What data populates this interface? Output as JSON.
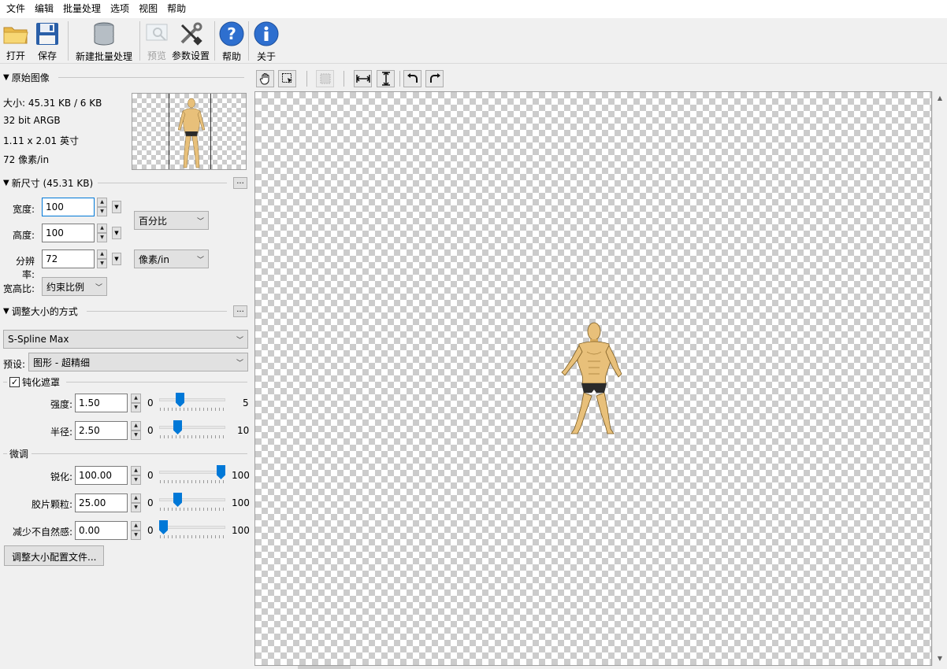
{
  "menu": [
    "文件",
    "编辑",
    "批量处理",
    "选项",
    "视图",
    "帮助"
  ],
  "toolbar": {
    "open": "打开",
    "save": "保存",
    "new_batch": "新建批量处理",
    "preview": "预览",
    "settings": "参数设置",
    "help": "帮助",
    "about": "关于"
  },
  "original": {
    "header": "原始图像",
    "size": "大小: 45.31 KB / 6 KB",
    "bits": "32 bit ARGB",
    "dimensions": "1.11 x 2.01 英寸",
    "resolution": "72 像素/in"
  },
  "new_size": {
    "header": "新尺寸 (45.31 KB)",
    "dots": "...",
    "width_label": "宽度:",
    "width_value": "100",
    "height_label": "高度:",
    "height_value": "100",
    "resolution_label": "分辨率:",
    "resolution_value": "72",
    "unit_size": "百分比",
    "unit_res": "像素/in",
    "aspect_label": "宽高比:",
    "aspect_value": "约束比例"
  },
  "method": {
    "header": "调整大小的方式",
    "dots": "...",
    "algorithm": "S-Spline Max",
    "preset_label": "预设:",
    "preset_value": "图形 - 超精细"
  },
  "unsharp": {
    "header": "钝化遮罩",
    "checked": true,
    "check_glyph": "✓",
    "strength_label": "强度:",
    "strength_value": "1.50",
    "strength_min": "0",
    "strength_max": "5",
    "radius_label": "半径:",
    "radius_value": "2.50",
    "radius_min": "0",
    "radius_max": "10"
  },
  "finetune": {
    "header": "微调",
    "sharpen_label": "锐化:",
    "sharpen_value": "100.00",
    "sharpen_min": "0",
    "sharpen_max": "100",
    "grain_label": "胶片颗粒:",
    "grain_value": "25.00",
    "grain_min": "0",
    "grain_max": "100",
    "artifact_label": "减少不自然感:",
    "artifact_value": "0.00",
    "artifact_min": "0",
    "artifact_max": "100"
  },
  "profile_button": "调整大小配置文件...",
  "colors": {
    "accent": "#0078d7",
    "skin": "#e8c07a",
    "shorts": "#2a2a2a"
  },
  "icons": [
    "open-folder-icon",
    "save-disk-icon",
    "batch-database-icon",
    "preview-icon",
    "settings-tools-icon",
    "help-icon",
    "info-icon",
    "hand-icon",
    "select-rect-icon",
    "crop-icon",
    "fit-width-icon",
    "fit-height-icon",
    "rotate-left-icon",
    "rotate-right-icon"
  ]
}
